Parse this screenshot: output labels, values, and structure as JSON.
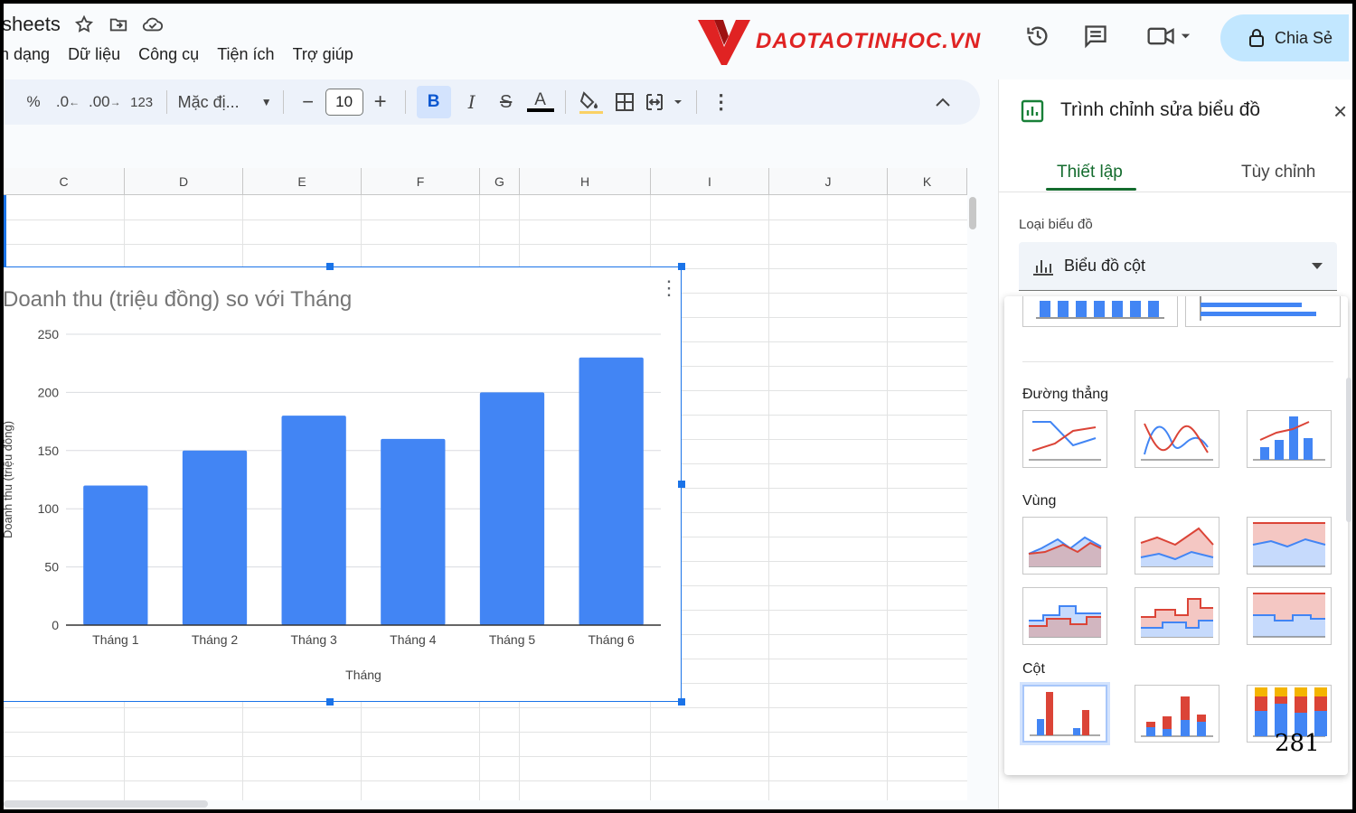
{
  "header": {
    "doc_title_fragment": "sheets",
    "menu": [
      "h dạng",
      "Dữ liệu",
      "Công cụ",
      "Tiện ích",
      "Trợ giúp"
    ],
    "logo_text": "DAOTAOTINHOC.VN",
    "share_label": "Chia Sẻ",
    "icons": [
      "star-icon",
      "move-folder-icon",
      "cloud-icon",
      "history-icon",
      "comment-icon",
      "video-call-icon",
      "lock-icon"
    ]
  },
  "toolbar": {
    "percent": "%",
    "decrease_decimal": ".0",
    "increase_decimal": ".00",
    "number_format": "123",
    "font_name": "Mặc đị...",
    "font_size": "10",
    "minus": "−",
    "plus": "+",
    "bold": "B",
    "italic": "I",
    "strike": "S",
    "text_color_letter": "A",
    "more": "⋮",
    "collapse": "^"
  },
  "columns": [
    "C",
    "D",
    "E",
    "F",
    "G",
    "H",
    "I",
    "J",
    "K"
  ],
  "chart_data": {
    "type": "bar",
    "title": "Doanh thu (triệu đồng) so với Tháng",
    "xlabel": "Tháng",
    "ylabel": "Doanh thu (triệu đồng)",
    "categories": [
      "Tháng 1",
      "Tháng 2",
      "Tháng 3",
      "Tháng 4",
      "Tháng 5",
      "Tháng 6"
    ],
    "values": [
      120,
      150,
      180,
      160,
      200,
      230
    ],
    "ylim": [
      0,
      250
    ],
    "yticks": [
      0,
      50,
      100,
      150,
      200,
      250
    ],
    "grid": true,
    "color": "#4285f4"
  },
  "panel": {
    "title": "Trình chỉnh sửa biểu đồ",
    "tabs": [
      "Thiết lập",
      "Tùy chỉnh"
    ],
    "chart_type_label": "Loại biểu đồ",
    "chart_type_value": "Biểu đồ cột",
    "sections": [
      "Đường thẳng",
      "Vùng",
      "Cột"
    ]
  },
  "page_number": "281",
  "colors": {
    "accent_blue": "#1a73e8",
    "series_blue": "#4285f4",
    "series_red": "#db4437",
    "tab_green": "#146c2e",
    "logo_red": "#e02323"
  }
}
